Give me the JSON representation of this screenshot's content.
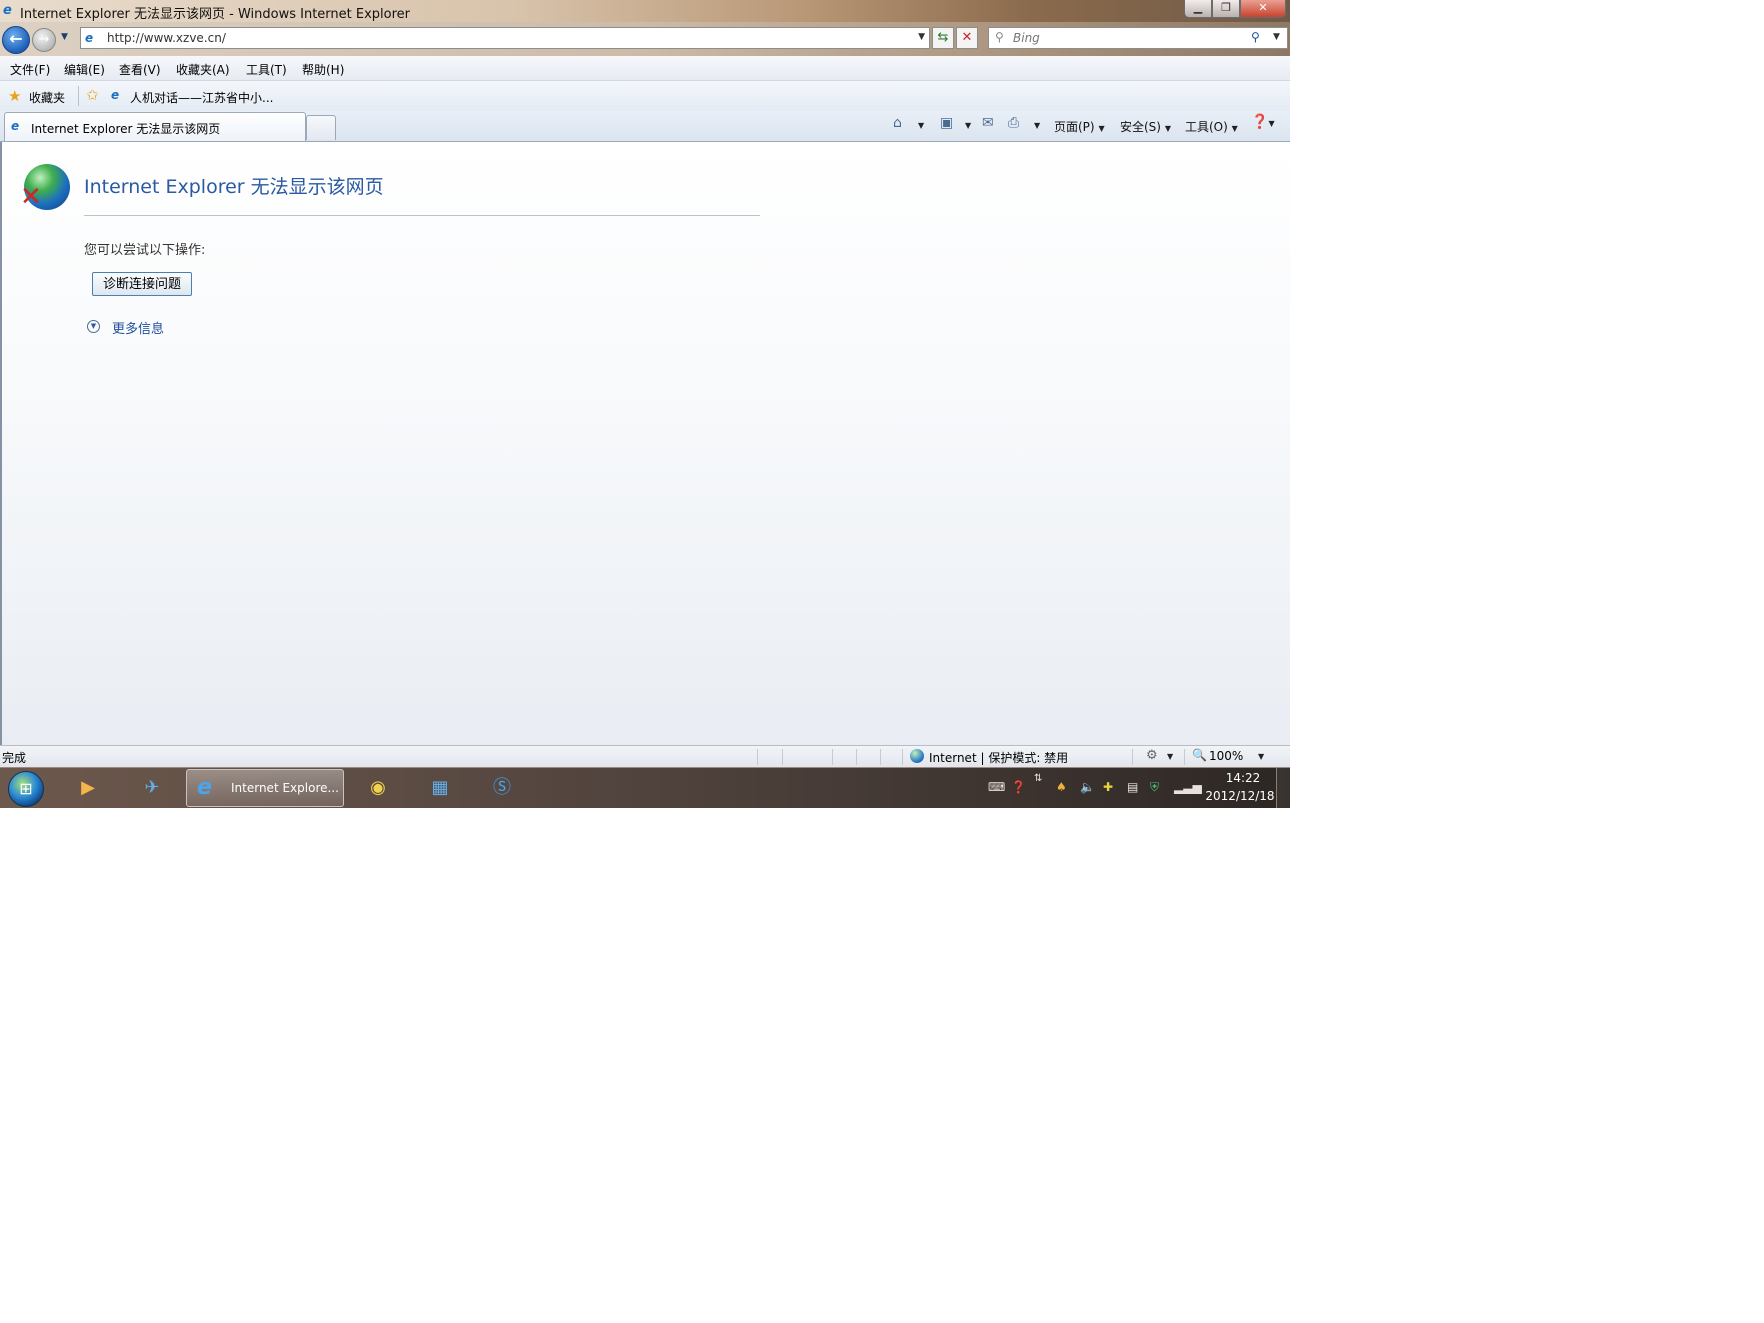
{
  "window": {
    "title": "Internet Explorer 无法显示该网页 - Windows Internet Explorer",
    "minimize": "▁",
    "maximize": "❐",
    "close": "✕"
  },
  "address": {
    "url": "http://www.xzve.cn/",
    "search_placeholder": "Bing"
  },
  "menu": [
    "文件(F)",
    "编辑(E)",
    "查看(V)",
    "收藏夹(A)",
    "工具(T)",
    "帮助(H)"
  ],
  "favorites": {
    "label": "收藏夹",
    "link": "人机对话——江苏省中小..."
  },
  "tab": {
    "label": "Internet Explorer 无法显示该网页"
  },
  "commands": {
    "page": "页面(P)",
    "safety": "安全(S)",
    "tools": "工具(O)"
  },
  "error_page": {
    "title": "Internet Explorer 无法显示该网页",
    "hint": "您可以尝试以下操作:",
    "diagnose_button": "诊断连接问题",
    "more_info": "更多信息"
  },
  "status": {
    "text": "完成",
    "zone": "Internet | 保护模式: 禁用",
    "zoom": "100%"
  },
  "taskbar": {
    "ie_label": "Internet Explore...",
    "time": "14:22",
    "date": "2012/12/18"
  },
  "icons": {
    "back": "back-arrow-icon",
    "forward": "forward-arrow-icon",
    "home": "home-icon",
    "feeds": "rss-icon",
    "mail": "mail-icon",
    "print": "print-icon",
    "help": "help-icon",
    "error": "globe-error-icon"
  },
  "colors": {
    "link_blue": "#1f4f9c",
    "title_blue": "#2a5aa3",
    "close_red": "#c7432c"
  }
}
